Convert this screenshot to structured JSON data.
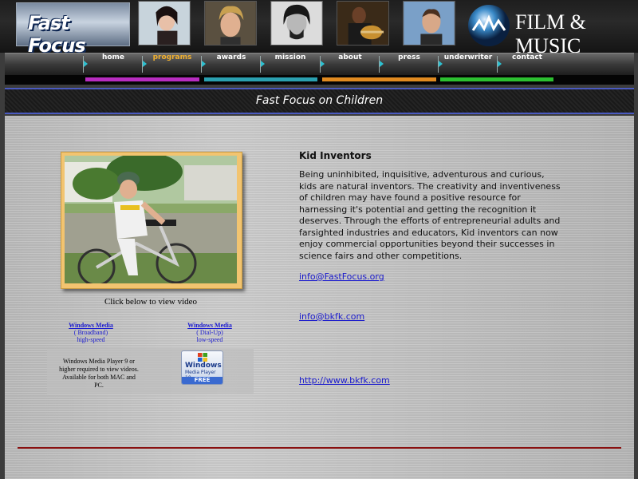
{
  "header": {
    "logo_text": "Fast Focus",
    "brand_text": "FILM & MUSIC"
  },
  "nav": {
    "items": [
      {
        "label": "home",
        "active": false
      },
      {
        "label": "programs",
        "active": true
      },
      {
        "label": "awards",
        "active": false
      },
      {
        "label": "mission",
        "active": false
      },
      {
        "label": "about",
        "active": false
      },
      {
        "label": "press",
        "active": false
      },
      {
        "label": "underwriter",
        "active": false
      },
      {
        "label": "contact",
        "active": false
      }
    ]
  },
  "colors": {
    "bar_magenta": "#b82cc0",
    "bar_teal": "#2aa0b0",
    "bar_orange": "#e08a20",
    "bar_green": "#2cc030",
    "nav_active": "#f0b030",
    "title_border": "#4a5ac0",
    "link": "#1a1acc",
    "rule": "#8a1010"
  },
  "page_title": "Fast Focus on Children",
  "video": {
    "caption": "Click below to view video",
    "broadband": {
      "link": "Windows Media",
      "line1": "( Broadband)",
      "line2": "high-speed"
    },
    "dialup": {
      "link": "Windows Media",
      "line1": "( Dial-Up)",
      "line2": "low-speed"
    },
    "requirement": "Windows Media Player 9 or higher required to view videos. Available for both MAC and PC.",
    "badge": {
      "windows": "Windows",
      "player": "Media Player 10",
      "free": "FREE"
    }
  },
  "article": {
    "title": "Kid Inventors",
    "body": "Being uninhibited, inquisitive, adventurous and curious, kids are natural inventors. The creativity and inventiveness of children may have found a positive resource for harnessing it's potential and getting the recognition it deserves. Through the efforts of entrepreneurial adults and farsighted industries and educators, Kid inventors can now enjoy commercial opportunities beyond their successes in science fairs and other competitions."
  },
  "links": {
    "email1": "info@FastFocus.org",
    "email2": "info@bkfk.com",
    "website": "http://www.bkfk.com "
  }
}
